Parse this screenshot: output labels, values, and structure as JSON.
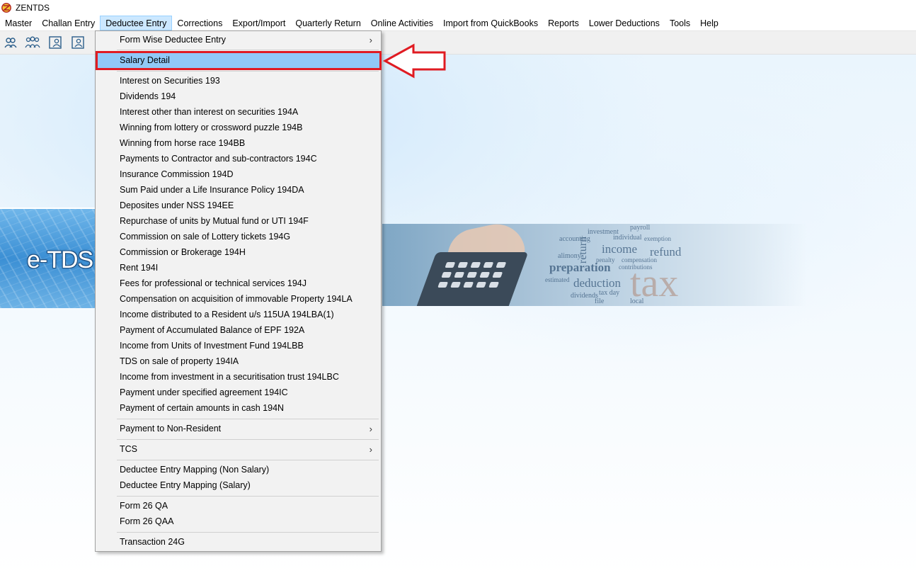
{
  "app": {
    "title": "ZENTDS"
  },
  "menubar": {
    "items": [
      {
        "label": "Master"
      },
      {
        "label": "Challan Entry"
      },
      {
        "label": "Deductee Entry",
        "active": true
      },
      {
        "label": "Corrections"
      },
      {
        "label": "Export/Import"
      },
      {
        "label": "Quarterly Return"
      },
      {
        "label": "Online Activities"
      },
      {
        "label": "Import from QuickBooks"
      },
      {
        "label": "Reports"
      },
      {
        "label": "Lower Deductions"
      },
      {
        "label": "Tools"
      },
      {
        "label": "Help"
      }
    ]
  },
  "toolbar": {
    "icons": [
      "user-pair-icon",
      "user-group-icon",
      "user-card-icon",
      "user-card-alt-icon"
    ]
  },
  "banner": {
    "text": "e-TDS"
  },
  "wordcloud": [
    "payroll",
    "investment",
    "accounting",
    "return",
    "income",
    "refund",
    "preparation",
    "deduction",
    "tax",
    "dividends",
    "alimony",
    "compensation",
    "penalty",
    "exemption",
    "individual",
    "contributions",
    "estimated",
    "tax day",
    "file",
    "local"
  ],
  "dropdown": {
    "items": [
      {
        "label": "Form Wise Deductee Entry",
        "submenu": true
      },
      {
        "label": "Salary Detail",
        "highlighted": true
      },
      {
        "label": "Interest on Securities 193"
      },
      {
        "label": "Dividends 194"
      },
      {
        "label": "Interest other than interest on securities 194A"
      },
      {
        "label": "Winning from lottery  or crossword puzzle 194B"
      },
      {
        "label": "Winning from horse race 194BB"
      },
      {
        "label": "Payments to Contractor and sub-contractors 194C"
      },
      {
        "label": "Insurance Commission 194D"
      },
      {
        "label": "Sum Paid under a Life Insurance Policy 194DA"
      },
      {
        "label": "Deposites under NSS 194EE"
      },
      {
        "label": "Repurchase of units by Mutual fund or UTI 194F"
      },
      {
        "label": "Commission on sale of Lottery tickets 194G"
      },
      {
        "label": "Commission or Brokerage 194H"
      },
      {
        "label": "Rent 194I"
      },
      {
        "label": "Fees for professional or technical services 194J"
      },
      {
        "label": "Compensation on acquisition of immovable Property 194LA"
      },
      {
        "label": "Income distributed to a Resident u/s 115UA 194LBA(1)"
      },
      {
        "label": "Payment of Accumulated Balance of EPF 192A"
      },
      {
        "label": "Income from Units of Investment Fund 194LBB"
      },
      {
        "label": "TDS on sale of property 194IA"
      },
      {
        "label": "Income from investment in a securitisation trust 194LBC"
      },
      {
        "label": "Payment under specified agreement 194IC"
      },
      {
        "label": "Payment of certain amounts in cash 194N"
      },
      {
        "label": "Payment to Non-Resident",
        "submenu": true
      },
      {
        "label": "TCS",
        "submenu": true
      },
      {
        "label": "Deductee Entry Mapping (Non Salary)"
      },
      {
        "label": "Deductee Entry Mapping (Salary)"
      },
      {
        "label": "Form 26 QA"
      },
      {
        "label": "Form 26 QAA"
      },
      {
        "label": "Transaction 24G"
      }
    ],
    "submenu_glyph": "›"
  },
  "colors": {
    "menu_active_bg": "#cce8ff",
    "dropdown_highlight": "#91c9f7",
    "annotation_red": "#e01b22"
  }
}
